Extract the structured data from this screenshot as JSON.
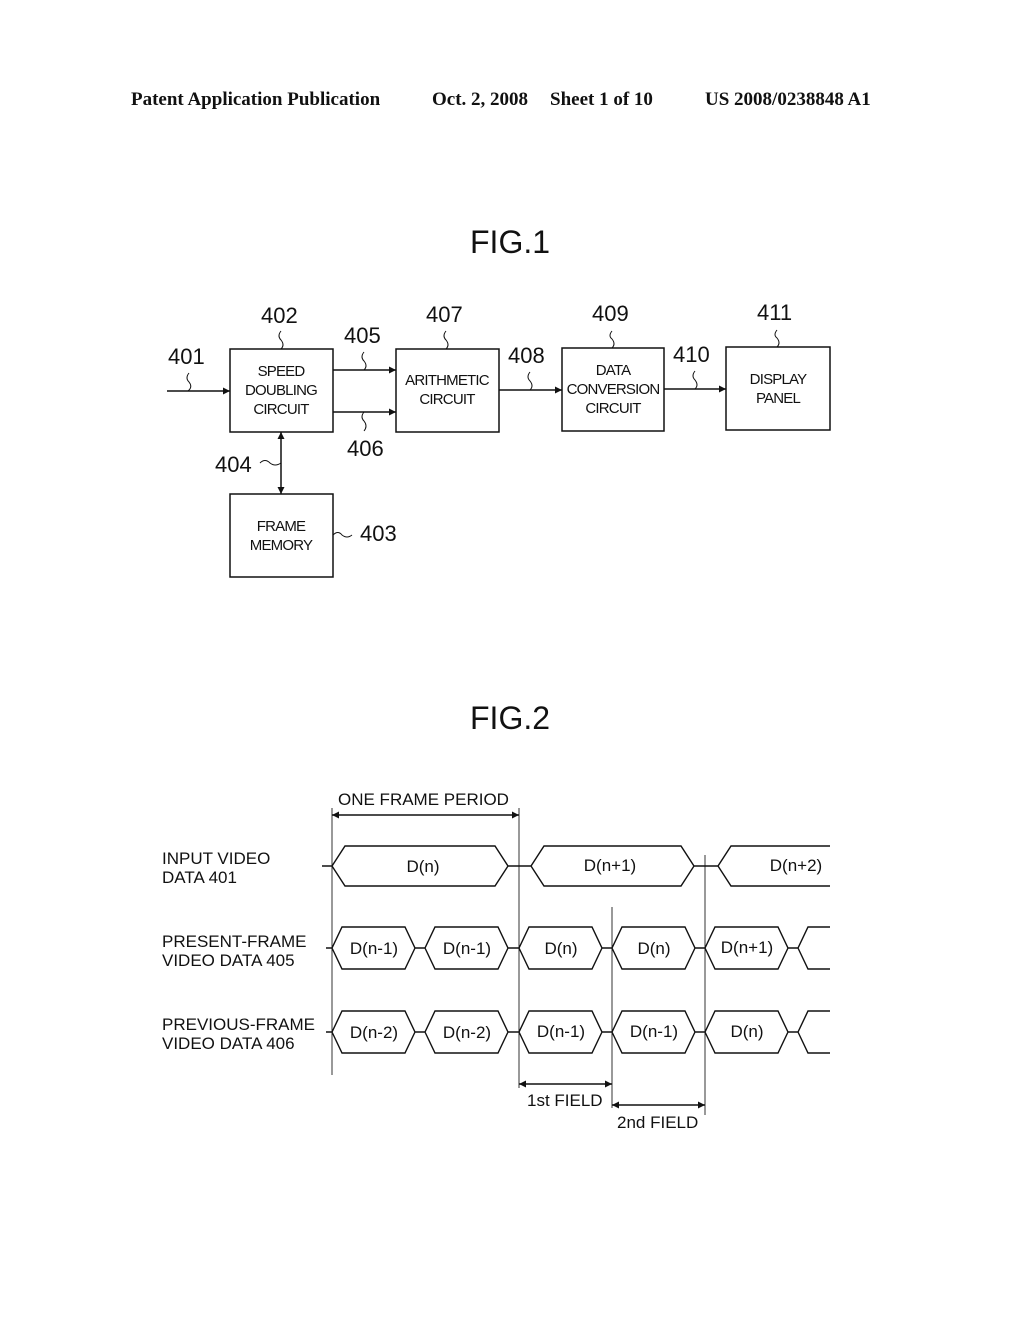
{
  "header": {
    "publication": "Patent Application Publication",
    "date": "Oct. 2, 2008",
    "sheet": "Sheet 1 of 10",
    "number": "US 2008/0238848 A1"
  },
  "fig1": {
    "title": "FIG.1",
    "blocks": [
      {
        "id": "speed-doubling",
        "ref": "402",
        "lines": [
          "SPEED",
          "DOUBLING",
          "CIRCUIT"
        ]
      },
      {
        "id": "arithmetic",
        "ref": "407",
        "lines": [
          "ARITHMETIC",
          "CIRCUIT"
        ]
      },
      {
        "id": "data-conversion",
        "ref": "409",
        "lines": [
          "DATA",
          "CONVERSION",
          "CIRCUIT"
        ]
      },
      {
        "id": "display-panel",
        "ref": "411",
        "lines": [
          "DISPLAY",
          "PANEL"
        ]
      },
      {
        "id": "frame-memory",
        "ref": "403",
        "lines": [
          "FRAME",
          "MEMORY"
        ]
      }
    ],
    "signals": {
      "input": "401",
      "memory_bus": "404",
      "present_frame": "405",
      "previous_frame": "406",
      "arith_out": "408",
      "conv_out": "410"
    }
  },
  "fig2": {
    "title": "FIG.2",
    "one_frame_period": "ONE FRAME PERIOD",
    "first_field": "1st FIELD",
    "second_field": "2nd FIELD",
    "rows": [
      {
        "label": [
          "INPUT VIDEO",
          "DATA 401"
        ],
        "cells": [
          "D(n)",
          "D(n+1)",
          "D(n+2)"
        ]
      },
      {
        "label": [
          "PRESENT-FRAME",
          "VIDEO DATA 405"
        ],
        "cells": [
          "D(n-1)",
          "D(n-1)",
          "D(n)",
          "D(n)",
          "D(n+1)"
        ]
      },
      {
        "label": [
          "PREVIOUS-FRAME",
          "VIDEO DATA 406"
        ],
        "cells": [
          "D(n-2)",
          "D(n-2)",
          "D(n-1)",
          "D(n-1)",
          "D(n)"
        ]
      }
    ]
  }
}
